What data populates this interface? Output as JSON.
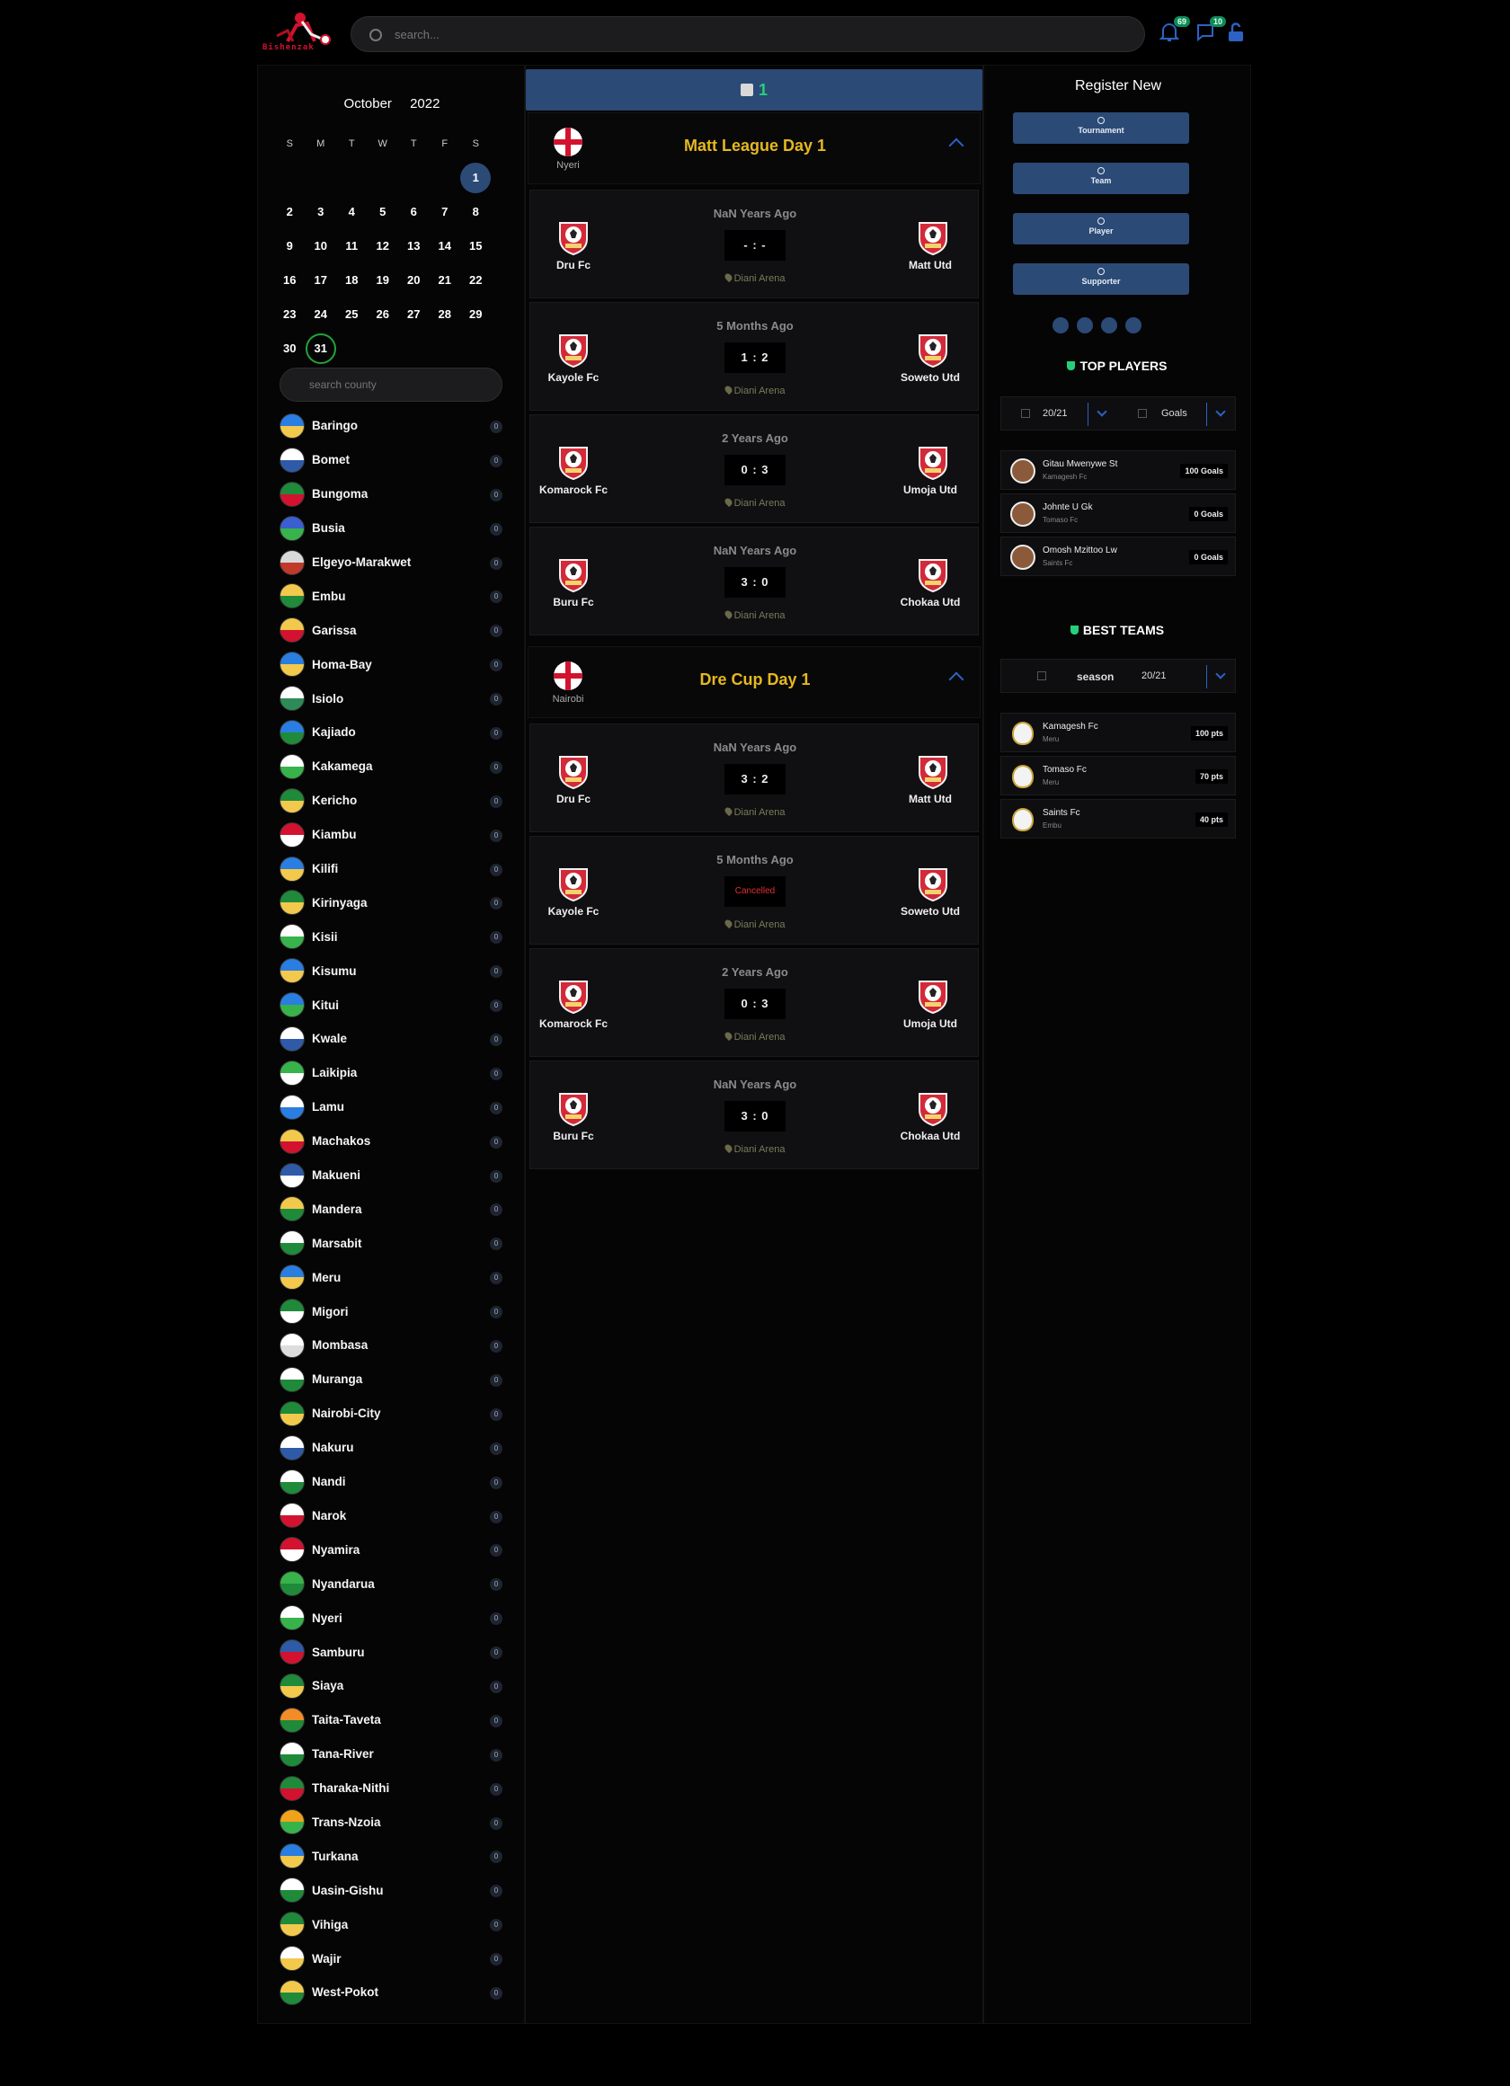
{
  "header": {
    "logo_text": "Bishenzak",
    "search_placeholder": "search...",
    "notifications_count": "69",
    "messages_count": "10"
  },
  "calendar": {
    "month": "October",
    "year": "2022",
    "weekdays": [
      "S",
      "M",
      "T",
      "W",
      "T",
      "F",
      "S"
    ],
    "weeks": [
      [
        "",
        "",
        "",
        "",
        "",
        "",
        "1"
      ],
      [
        "2",
        "3",
        "4",
        "5",
        "6",
        "7",
        "8"
      ],
      [
        "9",
        "10",
        "11",
        "12",
        "13",
        "14",
        "15"
      ],
      [
        "16",
        "17",
        "18",
        "19",
        "20",
        "21",
        "22"
      ],
      [
        "23",
        "24",
        "25",
        "26",
        "27",
        "28",
        "29"
      ],
      [
        "30",
        "31",
        "",
        "",
        "",
        "",
        ""
      ]
    ],
    "selected": "1",
    "today": "31"
  },
  "county_search_placeholder": "search county",
  "counties": [
    {
      "name": "Baringo",
      "count": "0",
      "c1": "#2a7de1",
      "c2": "#f2c94c"
    },
    {
      "name": "Bomet",
      "count": "0",
      "c1": "#ffffff",
      "c2": "#2e5aa8"
    },
    {
      "name": "Bungoma",
      "count": "0",
      "c1": "#1e8a3a",
      "c2": "#d3122f"
    },
    {
      "name": "Busia",
      "count": "0",
      "c1": "#3b5fd1",
      "c2": "#38b24a"
    },
    {
      "name": "Elgeyo-Marakwet",
      "count": "0",
      "c1": "#d9d9d9",
      "c2": "#c0392b"
    },
    {
      "name": "Embu",
      "count": "0",
      "c1": "#f2c94c",
      "c2": "#1e8a3a"
    },
    {
      "name": "Garissa",
      "count": "0",
      "c1": "#f2c94c",
      "c2": "#d3122f"
    },
    {
      "name": "Homa-Bay",
      "count": "0",
      "c1": "#2a7de1",
      "c2": "#f2c94c"
    },
    {
      "name": "Isiolo",
      "count": "0",
      "c1": "#ffffff",
      "c2": "#2e8b57"
    },
    {
      "name": "Kajiado",
      "count": "0",
      "c1": "#2a7de1",
      "c2": "#1e8a3a"
    },
    {
      "name": "Kakamega",
      "count": "0",
      "c1": "#ffffff",
      "c2": "#38b24a"
    },
    {
      "name": "Kericho",
      "count": "0",
      "c1": "#1e8a3a",
      "c2": "#f2c94c"
    },
    {
      "name": "Kiambu",
      "count": "0",
      "c1": "#d3122f",
      "c2": "#ffffff"
    },
    {
      "name": "Kilifi",
      "count": "0",
      "c1": "#2a7de1",
      "c2": "#f2c94c"
    },
    {
      "name": "Kirinyaga",
      "count": "0",
      "c1": "#1e8a3a",
      "c2": "#f2c94c"
    },
    {
      "name": "Kisii",
      "count": "0",
      "c1": "#ffffff",
      "c2": "#38b24a"
    },
    {
      "name": "Kisumu",
      "count": "0",
      "c1": "#2a7de1",
      "c2": "#f2c94c"
    },
    {
      "name": "Kitui",
      "count": "0",
      "c1": "#2a7de1",
      "c2": "#38b24a"
    },
    {
      "name": "Kwale",
      "count": "0",
      "c1": "#ffffff",
      "c2": "#2e5aa8"
    },
    {
      "name": "Laikipia",
      "count": "0",
      "c1": "#38b24a",
      "c2": "#ffffff"
    },
    {
      "name": "Lamu",
      "count": "0",
      "c1": "#ffffff",
      "c2": "#2a7de1"
    },
    {
      "name": "Machakos",
      "count": "0",
      "c1": "#f2c94c",
      "c2": "#d3122f"
    },
    {
      "name": "Makueni",
      "count": "0",
      "c1": "#2e5aa8",
      "c2": "#ffffff"
    },
    {
      "name": "Mandera",
      "count": "0",
      "c1": "#f2c94c",
      "c2": "#1e8a3a"
    },
    {
      "name": "Marsabit",
      "count": "0",
      "c1": "#ffffff",
      "c2": "#1e8a3a"
    },
    {
      "name": "Meru",
      "count": "0",
      "c1": "#2a7de1",
      "c2": "#f2c94c"
    },
    {
      "name": "Migori",
      "count": "0",
      "c1": "#1e8a3a",
      "c2": "#ffffff"
    },
    {
      "name": "Mombasa",
      "count": "0",
      "c1": "#ffffff",
      "c2": "#dddddd"
    },
    {
      "name": "Muranga",
      "count": "0",
      "c1": "#ffffff",
      "c2": "#1e8a3a"
    },
    {
      "name": "Nairobi-City",
      "count": "0",
      "c1": "#1e8a3a",
      "c2": "#f2c94c"
    },
    {
      "name": "Nakuru",
      "count": "0",
      "c1": "#ffffff",
      "c2": "#2e5aa8"
    },
    {
      "name": "Nandi",
      "count": "0",
      "c1": "#ffffff",
      "c2": "#1e8a3a"
    },
    {
      "name": "Narok",
      "count": "0",
      "c1": "#ffffff",
      "c2": "#d3122f"
    },
    {
      "name": "Nyamira",
      "count": "0",
      "c1": "#d3122f",
      "c2": "#ffffff"
    },
    {
      "name": "Nyandarua",
      "count": "0",
      "c1": "#38b24a",
      "c2": "#1e8a3a"
    },
    {
      "name": "Nyeri",
      "count": "0",
      "c1": "#ffffff",
      "c2": "#38b24a"
    },
    {
      "name": "Samburu",
      "count": "0",
      "c1": "#2e5aa8",
      "c2": "#d3122f"
    },
    {
      "name": "Siaya",
      "count": "0",
      "c1": "#1e8a3a",
      "c2": "#f2c94c"
    },
    {
      "name": "Taita-Taveta",
      "count": "0",
      "c1": "#f28c28",
      "c2": "#1e8a3a"
    },
    {
      "name": "Tana-River",
      "count": "0",
      "c1": "#ffffff",
      "c2": "#1e8a3a"
    },
    {
      "name": "Tharaka-Nithi",
      "count": "0",
      "c1": "#1e8a3a",
      "c2": "#d3122f"
    },
    {
      "name": "Trans-Nzoia",
      "count": "0",
      "c1": "#f2a21a",
      "c2": "#38b24a"
    },
    {
      "name": "Turkana",
      "count": "0",
      "c1": "#2a7de1",
      "c2": "#f2c94c"
    },
    {
      "name": "Uasin-Gishu",
      "count": "0",
      "c1": "#ffffff",
      "c2": "#1e8a3a"
    },
    {
      "name": "Vihiga",
      "count": "0",
      "c1": "#1e8a3a",
      "c2": "#f2c94c"
    },
    {
      "name": "Wajir",
      "count": "0",
      "c1": "#ffffff",
      "c2": "#f2c94c"
    },
    {
      "name": "West-Pokot",
      "count": "0",
      "c1": "#f2c94c",
      "c2": "#1e8a3a"
    }
  ],
  "feed": {
    "top_count": "1",
    "leagues": [
      {
        "title": "Matt League Day 1",
        "region": "Nyeri",
        "matches": [
          {
            "ago": "NaN Years Ago",
            "home": "Dru Fc",
            "away": "Matt Utd",
            "score": "- : -",
            "venue": "Diani Arena",
            "cancelled": false
          },
          {
            "ago": "5 Months Ago",
            "home": "Kayole Fc",
            "away": "Soweto Utd",
            "score": "1 : 2",
            "venue": "Diani Arena",
            "cancelled": false
          },
          {
            "ago": "2 Years Ago",
            "home": "Komarock Fc",
            "away": "Umoja Utd",
            "score": "0 : 3",
            "venue": "Diani Arena",
            "cancelled": false
          },
          {
            "ago": "NaN Years Ago",
            "home": "Buru Fc",
            "away": "Chokaa Utd",
            "score": "3 : 0",
            "venue": "Diani Arena",
            "cancelled": false
          }
        ]
      },
      {
        "title": "Dre Cup Day 1",
        "region": "Nairobi",
        "matches": [
          {
            "ago": "NaN Years Ago",
            "home": "Dru Fc",
            "away": "Matt Utd",
            "score": "3 : 2",
            "venue": "Diani Arena",
            "cancelled": false
          },
          {
            "ago": "5 Months Ago",
            "home": "Kayole Fc",
            "away": "Soweto Utd",
            "score": "Cancelled",
            "venue": "Diani Arena",
            "cancelled": true
          },
          {
            "ago": "2 Years Ago",
            "home": "Komarock Fc",
            "away": "Umoja Utd",
            "score": "0 : 3",
            "venue": "Diani Arena",
            "cancelled": false
          },
          {
            "ago": "NaN Years Ago",
            "home": "Buru Fc",
            "away": "Chokaa Utd",
            "score": "3 : 0",
            "venue": "Diani Arena",
            "cancelled": false
          }
        ]
      }
    ]
  },
  "register": {
    "title": "Register New",
    "buttons": [
      "Tournament",
      "Team",
      "Player",
      "Supporter"
    ]
  },
  "top_players": {
    "title": "TOP PLAYERS",
    "season": "20/21",
    "stat": "Goals",
    "items": [
      {
        "name": "Gitau Mwenywe St",
        "team": "Kamagesh Fc",
        "value": "100 Goals"
      },
      {
        "name": "Johnte U Gk",
        "team": "Tomaso Fc",
        "value": "0 Goals"
      },
      {
        "name": "Omosh Mzittoo Lw",
        "team": "Saints Fc",
        "value": "0 Goals"
      }
    ]
  },
  "best_teams": {
    "title": "BEST TEAMS",
    "label": "season",
    "season": "20/21",
    "items": [
      {
        "name": "Kamagesh Fc",
        "county": "Meru",
        "value": "100 pts"
      },
      {
        "name": "Tomaso Fc",
        "county": "Meru",
        "value": "70 pts"
      },
      {
        "name": "Saints Fc",
        "county": "Embu",
        "value": "40 pts"
      }
    ]
  }
}
